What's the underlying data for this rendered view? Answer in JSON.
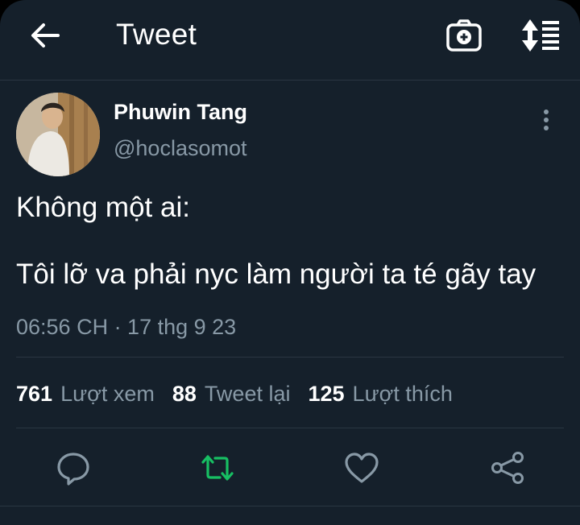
{
  "header": {
    "title": "Tweet",
    "icons": [
      "back-arrow-icon",
      "camera-plus-icon",
      "sort-list-icon"
    ]
  },
  "tweet": {
    "author": {
      "display_name": "Phuwin Tang",
      "handle": "@hoclasomot"
    },
    "text_lines": [
      "Không một ai:",
      "Tôi lỡ va phải nyc làm người ta té gãy tay"
    ],
    "timestamp": "06:56 CH · 17 thg 9 23",
    "stats": [
      {
        "number": "761",
        "label": "Lượt xem"
      },
      {
        "number": "88",
        "label": "Tweet lại"
      },
      {
        "number": "125",
        "label": "Lượt thích"
      }
    ],
    "actions": [
      "reply-icon",
      "retweet-icon",
      "like-icon",
      "share-icon"
    ]
  },
  "colors": {
    "background": "#15202b",
    "text": "#ffffff",
    "secondary": "#8899a6",
    "retweet_accent": "#17bf63",
    "divider": "#2a3642"
  }
}
